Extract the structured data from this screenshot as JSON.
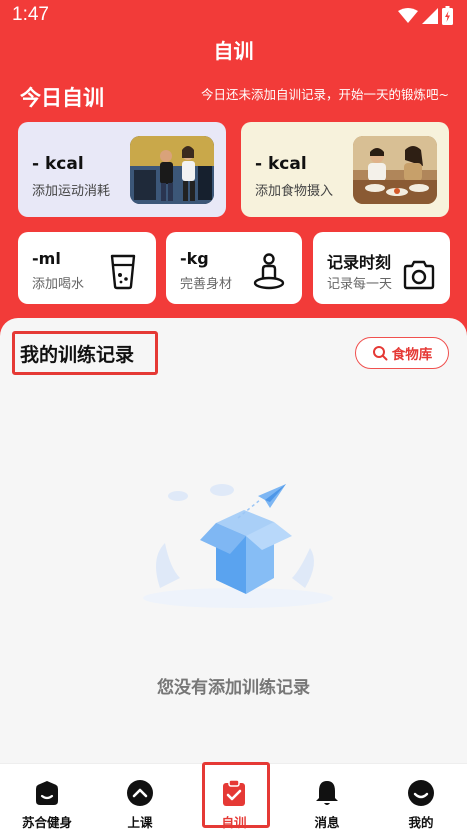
{
  "status": {
    "time": "1:47"
  },
  "app": {
    "title": "自训"
  },
  "today": {
    "title": "今日自训",
    "hint": "今日还未添加自训记录，开始一天的锻炼吧~"
  },
  "cards": [
    {
      "value": "- kcal",
      "label": "添加运动消耗",
      "icon": "gym-workout-photo"
    },
    {
      "value": "- kcal",
      "label": "添加食物摄入",
      "icon": "dining-photo"
    }
  ],
  "small_cards": [
    {
      "value": "-ml",
      "label": "添加喝水",
      "icon": "water-cup-icon"
    },
    {
      "value": "-kg",
      "label": "完善身材",
      "icon": "body-scale-icon"
    },
    {
      "value": "记录时刻",
      "label": "记录每一天",
      "icon": "camera-icon"
    }
  ],
  "records": {
    "title": "我的训练记录",
    "food_button": "食物库",
    "empty_text": "您没有添加训练记录"
  },
  "nav": [
    {
      "label": "苏合健身",
      "icon": "home-icon",
      "active": false
    },
    {
      "label": "上课",
      "icon": "chevron-up-circle-icon",
      "active": false
    },
    {
      "label": "自训",
      "icon": "clipboard-check-icon",
      "active": true
    },
    {
      "label": "消息",
      "icon": "bell-icon",
      "active": false
    },
    {
      "label": "我的",
      "icon": "profile-icon",
      "active": false
    }
  ],
  "colors": {
    "brand_red": "#f23b39",
    "accent_red": "#e53935"
  }
}
